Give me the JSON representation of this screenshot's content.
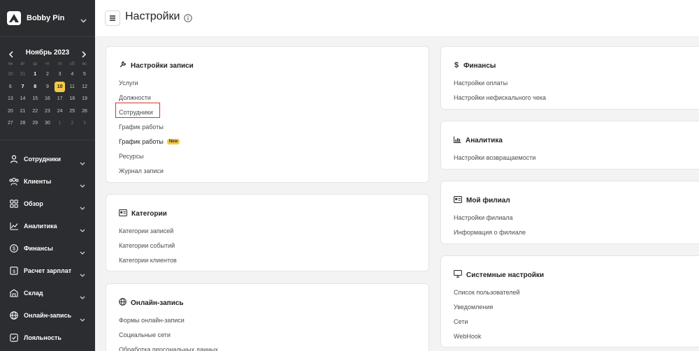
{
  "brand": {
    "name": "Bobby Pin"
  },
  "calendar": {
    "title": "Ноябрь 2023",
    "weekdays": [
      "пн",
      "вт",
      "ср",
      "чт",
      "пт",
      "сб",
      "вс"
    ],
    "weeks": [
      [
        "30",
        "31",
        "1",
        "2",
        "3",
        "4",
        "5"
      ],
      [
        "6",
        "7",
        "8",
        "9",
        "10",
        "11",
        "12"
      ],
      [
        "13",
        "14",
        "15",
        "16",
        "17",
        "18",
        "19"
      ],
      [
        "20",
        "21",
        "22",
        "23",
        "24",
        "25",
        "26"
      ],
      [
        "27",
        "28",
        "29",
        "30",
        "1",
        "2",
        "3"
      ]
    ],
    "today": "10",
    "accent_color": "#f5c842"
  },
  "nav": [
    {
      "label": "Сотрудники",
      "icon": "user-icon",
      "chevron": true
    },
    {
      "label": "Клиенты",
      "icon": "users-icon",
      "chevron": true
    },
    {
      "label": "Обзор",
      "icon": "grid-icon",
      "chevron": true
    },
    {
      "label": "Аналитика",
      "icon": "chart-line-icon",
      "chevron": true
    },
    {
      "label": "Финансы",
      "icon": "dollar-icon",
      "chevron": true
    },
    {
      "label": "Расчет зарплат",
      "icon": "payroll-icon",
      "chevron": true
    },
    {
      "label": "Склад",
      "icon": "warehouse-icon",
      "chevron": true
    },
    {
      "label": "Онлайн-запись",
      "icon": "globe-icon",
      "chevron": true
    },
    {
      "label": "Лояльность",
      "icon": "loyalty-icon",
      "chevron": false
    }
  ],
  "header": {
    "title": "Настройки"
  },
  "cards": {
    "booking": {
      "title": "Настройки записи",
      "links": [
        "Услуги",
        "Должности",
        "Сотрудники",
        "График работы",
        "График работы",
        "Ресурсы",
        "Журнал записи"
      ],
      "new_badge": "New"
    },
    "categories": {
      "title": "Категории",
      "links": [
        "Категории записей",
        "Категории событий",
        "Категории клиентов"
      ]
    },
    "online": {
      "title": "Онлайн-запись",
      "links": [
        "Формы онлайн-записи",
        "Социальные сети",
        "Обработка персональных данных"
      ]
    },
    "finance": {
      "title": "Финансы",
      "links": [
        "Настройки оплаты",
        "Настройки нефискального чека"
      ]
    },
    "analytics": {
      "title": "Аналитика",
      "links": [
        "Настройки возвращаемости"
      ]
    },
    "branch": {
      "title": "Мой филиал",
      "links": [
        "Настройки филиала",
        "Информация о филиале"
      ]
    },
    "system": {
      "title": "Системные настройки",
      "links": [
        "Список пользователей",
        "Уведомления",
        "Сети",
        "WebHook"
      ]
    }
  },
  "highlight_color": "#d9332b"
}
